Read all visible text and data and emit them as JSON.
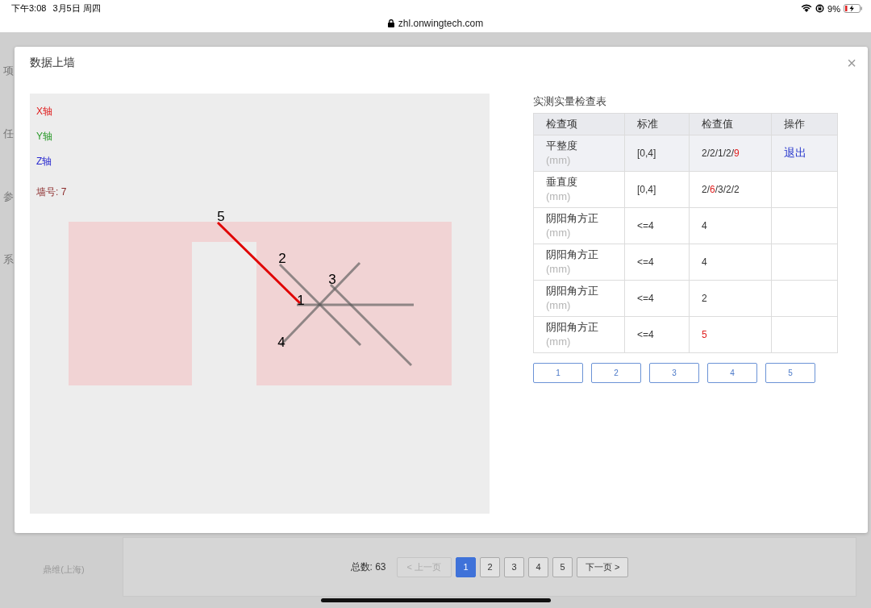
{
  "status_bar": {
    "time": "下午3:08",
    "date": "3月5日 周四",
    "url": "zhl.onwingtech.com",
    "battery": "9%"
  },
  "sidebar": {
    "items": [
      "项",
      "任",
      "参",
      "系"
    ],
    "footer": "鼎维(上海)"
  },
  "modal": {
    "title": "数据上墙",
    "close": "×",
    "canvas": {
      "legend": [
        {
          "label": "X轴",
          "color": "#e02020"
        },
        {
          "label": "Y轴",
          "color": "#2a9a2a"
        },
        {
          "label": "Z轴",
          "color": "#2a2ad0"
        }
      ],
      "wall_number": "墙号: 7",
      "measure_lines": [
        {
          "label": "5",
          "highlighted": true
        },
        {
          "label": "2",
          "highlighted": false
        },
        {
          "label": "3",
          "highlighted": false
        },
        {
          "label": "1",
          "highlighted": false
        },
        {
          "label": "4",
          "highlighted": false
        }
      ]
    },
    "table": {
      "title": "实测实量检查表",
      "columns": [
        "检查项",
        "标准",
        "检查值",
        "操作"
      ],
      "rows": [
        {
          "item": "平整度",
          "unit": "(mm)",
          "standard": "[0,4]",
          "value": [
            {
              "text": "2/2/1/2/",
              "alert": false
            },
            {
              "text": "9",
              "alert": true
            }
          ],
          "action": "退出",
          "selected": true
        },
        {
          "item": "垂直度",
          "unit": "(mm)",
          "standard": "[0,4]",
          "value": [
            {
              "text": "2/",
              "alert": false
            },
            {
              "text": "6",
              "alert": true
            },
            {
              "text": "/3/2/2",
              "alert": false
            }
          ],
          "selected": false
        },
        {
          "item": "阴阳角方正",
          "unit": "(mm)",
          "standard": "<=4",
          "value": [
            {
              "text": "4",
              "alert": false
            }
          ],
          "selected": false
        },
        {
          "item": "阴阳角方正",
          "unit": "(mm)",
          "standard": "<=4",
          "value": [
            {
              "text": "4",
              "alert": false
            }
          ],
          "selected": false
        },
        {
          "item": "阴阳角方正",
          "unit": "(mm)",
          "standard": "<=4",
          "value": [
            {
              "text": "2",
              "alert": false
            }
          ],
          "selected": false
        },
        {
          "item": "阴阳角方正",
          "unit": "(mm)",
          "standard": "<=4",
          "value": [
            {
              "text": "5",
              "alert": true
            }
          ],
          "selected": false
        }
      ]
    },
    "point_buttons": [
      "1",
      "2",
      "3",
      "4",
      "5"
    ]
  },
  "pagination": {
    "total": "总数: 63",
    "prev": {
      "label": "< 上一页",
      "disabled": true
    },
    "pages": [
      {
        "label": "1",
        "selected": true
      },
      {
        "label": "2",
        "selected": false
      },
      {
        "label": "3",
        "selected": false
      },
      {
        "label": "4",
        "selected": false
      },
      {
        "label": "5",
        "selected": false
      }
    ],
    "next": {
      "label": "下一页 >",
      "disabled": false
    }
  }
}
